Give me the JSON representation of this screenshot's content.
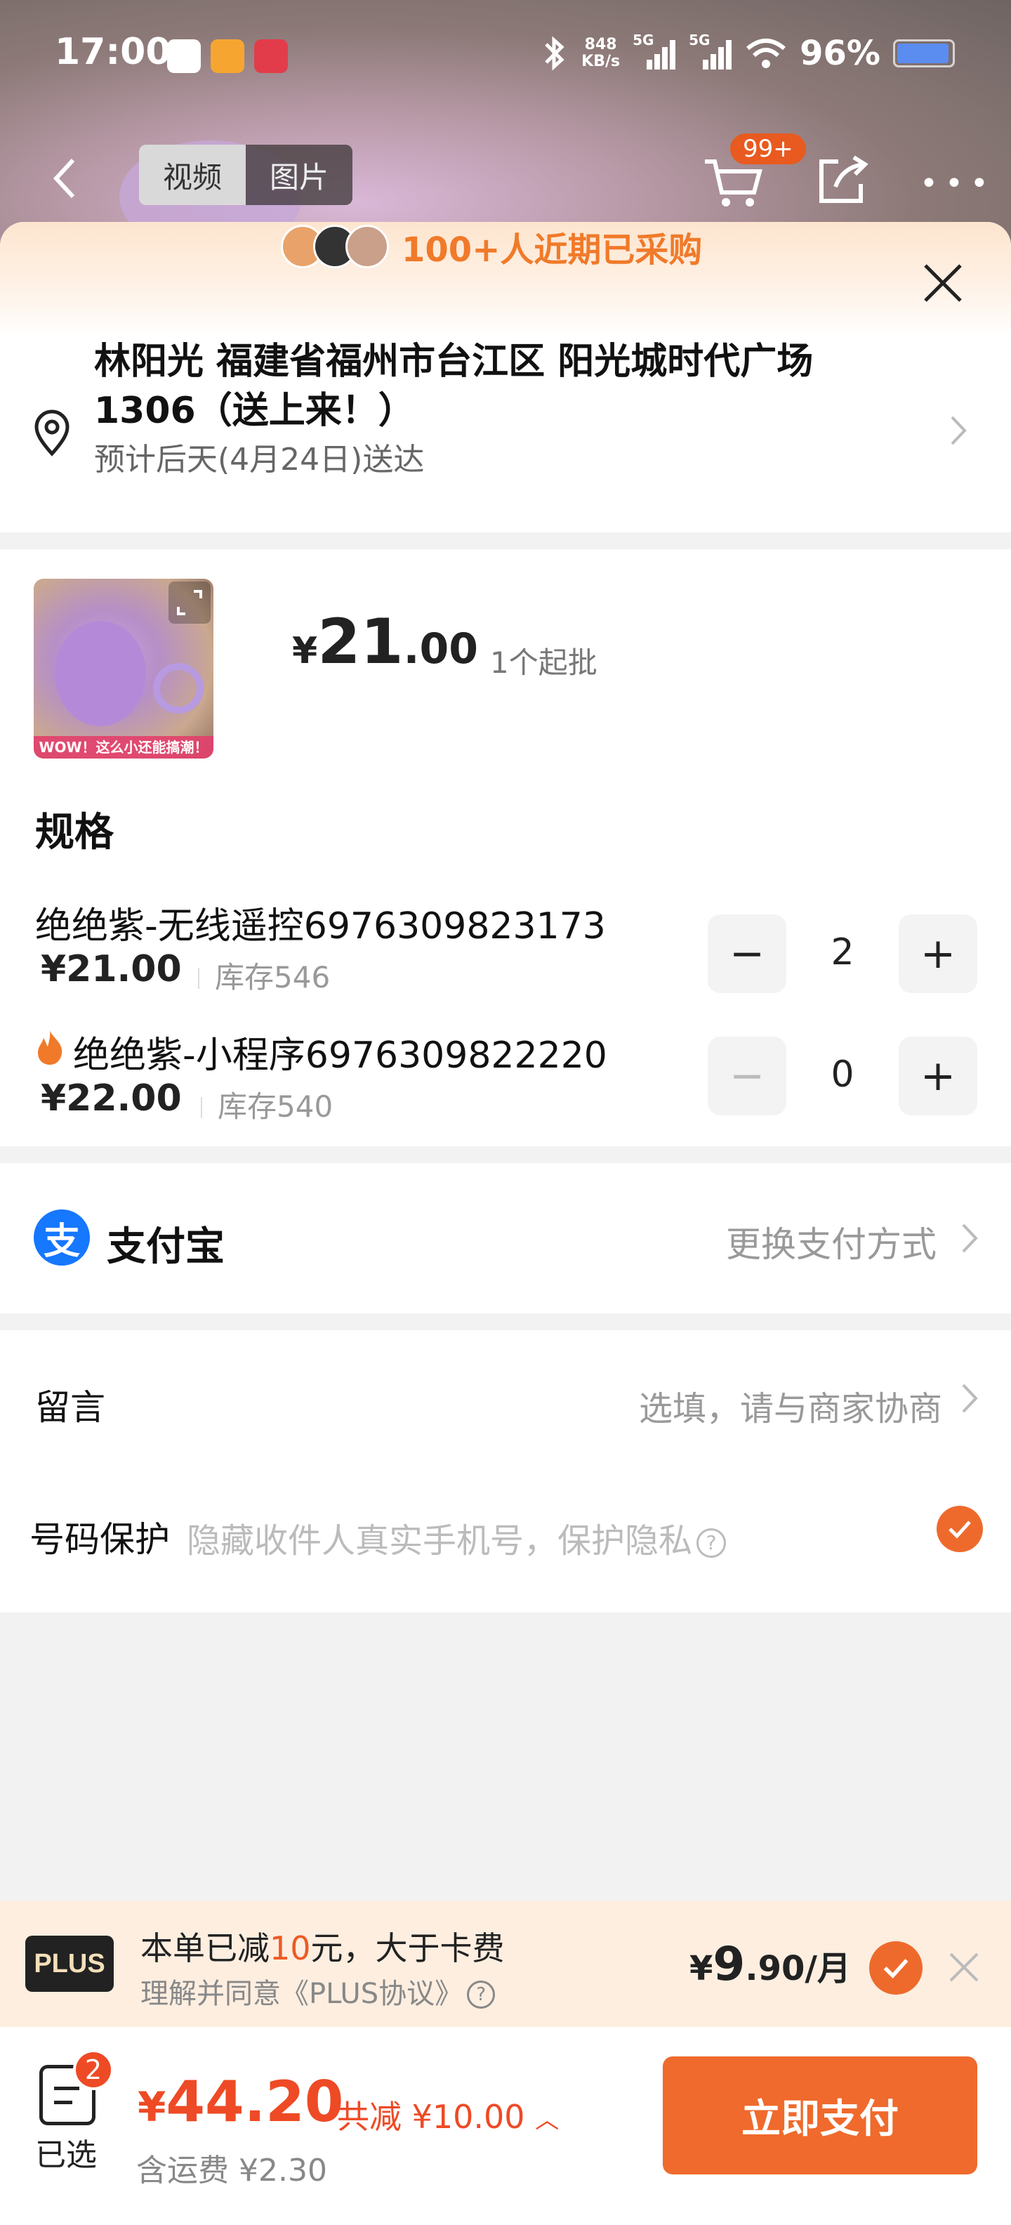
{
  "status_bar": {
    "time": "17:00",
    "net_speed_value": "848",
    "net_speed_unit": "KB/s",
    "signal1": "5G",
    "signal2": "5G",
    "battery": "96%"
  },
  "nav": {
    "tabs": [
      {
        "label": "视频",
        "active": true
      },
      {
        "label": "图片",
        "active": false
      }
    ],
    "cart_badge": "99+",
    "icons": [
      "back-icon",
      "cart-icon",
      "share-icon",
      "more-icon"
    ]
  },
  "sheet": {
    "buyers_text": "100+人近期已采购"
  },
  "address": {
    "line1": "林阳光 福建省福州市台江区 阳光城时代广场",
    "line2": "1306（送上来！）",
    "eta": "预计后天(4月24日)送达"
  },
  "product": {
    "thumb_caption": "WOW！这么小还能搞潮！",
    "price_symbol": "¥",
    "price_int": "21",
    "price_dec": ".00",
    "min_batch": "1个起批",
    "spec_title": "规格",
    "variants": [
      {
        "name": "绝绝紫-无线遥控6976309823173",
        "price": "¥21.00",
        "stock": "库存546",
        "qty": "2",
        "hot": false
      },
      {
        "name": "绝绝紫-小程序6976309822220",
        "price": "¥22.00",
        "stock": "库存540",
        "qty": "0",
        "hot": true
      }
    ]
  },
  "payment": {
    "method": "支付宝",
    "change_label": "更换支付方式",
    "icon_char": "支"
  },
  "message": {
    "label": "留言",
    "hint": "选填，请与商家协商"
  },
  "privacy": {
    "label": "号码保护",
    "hint": "隐藏收件人真实手机号，保护隐私",
    "help": "?",
    "checked": true
  },
  "plus": {
    "logo": "PLUS",
    "title_pre": "本单已减",
    "title_amount": "10",
    "title_post": "元，大于卡费",
    "sub": "理解并同意《PLUS协议》",
    "price_symbol": "¥",
    "price_int": "9",
    "price_rest": ".90/月"
  },
  "bottom": {
    "selected_count": "2",
    "selected_label": "已选",
    "total_symbol": "¥",
    "total_value": "44.20",
    "discount": "共减 ¥10.00",
    "shipping": "含运费 ¥2.30",
    "pay_button": "立即支付"
  },
  "colors": {
    "accent": "#ef6a2c",
    "price_red": "#ee4a25",
    "alipay_blue": "#1677ff"
  }
}
